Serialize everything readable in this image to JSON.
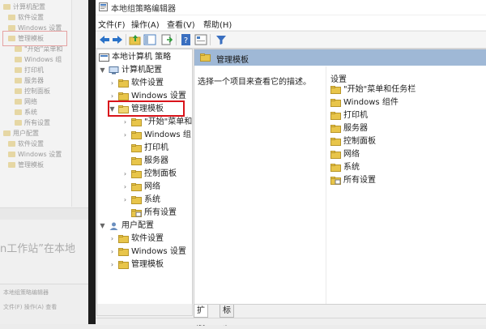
{
  "background_window": {
    "tree": [
      {
        "label": "计算机配置",
        "indent": 0
      },
      {
        "label": "软件设置",
        "indent": 1
      },
      {
        "label": "Windows 设置",
        "indent": 1
      },
      {
        "label": "管理模板",
        "indent": 1
      },
      {
        "label": "\"开始\"菜单和",
        "indent": 2
      },
      {
        "label": "Windows 组",
        "indent": 2
      },
      {
        "label": "打印机",
        "indent": 2
      },
      {
        "label": "服务器",
        "indent": 2
      },
      {
        "label": "控制面板",
        "indent": 2
      },
      {
        "label": "网络",
        "indent": 2
      },
      {
        "label": "系统",
        "indent": 2
      },
      {
        "label": "所有设置",
        "indent": 2
      },
      {
        "label": "用户配置",
        "indent": 0
      },
      {
        "label": "软件设置",
        "indent": 1
      },
      {
        "label": "Windows 设置",
        "indent": 1
      },
      {
        "label": "管理模板",
        "indent": 1
      }
    ],
    "caption": "n工作站”在本地",
    "window2_title": "本地组策略编辑器",
    "window2_menu": "文件(F)  操作(A)  查看"
  },
  "window": {
    "title": "本地组策略编辑器",
    "menu": [
      "文件(F)",
      "操作(A)",
      "查看(V)",
      "帮助(H)"
    ],
    "toolbar_icons": [
      "back-arrow-icon",
      "forward-arrow-icon",
      "up-folder-icon",
      "show-hide-tree-icon",
      "export-list-icon",
      "help-icon",
      "properties-icon",
      "filter-icon"
    ]
  },
  "tree": {
    "root": "本地计算机 策略",
    "computer_config": "计算机配置",
    "software_settings": "软件设置",
    "windows_settings": "Windows 设置",
    "admin_templates": "管理模板",
    "start_menu": "\"开始\"菜单和",
    "windows_components": "Windows 组",
    "printers": "打印机",
    "server": "服务器",
    "control_panel": "控制面板",
    "network": "网络",
    "system": "系统",
    "all_settings": "所有设置",
    "user_config": "用户配置",
    "user_software_settings": "软件设置",
    "user_windows_settings": "Windows 设置",
    "user_admin_templates": "管理模板"
  },
  "right_pane": {
    "header": "管理模板",
    "description": "选择一个项目来查看它的描述。",
    "column_header": "设置",
    "items": [
      {
        "label": "\"开始\"菜单和任务栏",
        "icon": "folder-icon"
      },
      {
        "label": "Windows 组件",
        "icon": "folder-icon"
      },
      {
        "label": "打印机",
        "icon": "folder-icon"
      },
      {
        "label": "服务器",
        "icon": "folder-icon"
      },
      {
        "label": "控制面板",
        "icon": "folder-icon"
      },
      {
        "label": "网络",
        "icon": "folder-icon"
      },
      {
        "label": "系统",
        "icon": "folder-icon"
      },
      {
        "label": "所有设置",
        "icon": "settings-folder-icon"
      }
    ]
  },
  "tabs": [
    "扩展",
    "标准"
  ],
  "colors": {
    "header_blue": "#9fb8d6",
    "highlight_red": "#d9141b",
    "folder_yellow": "#e8c54a"
  }
}
